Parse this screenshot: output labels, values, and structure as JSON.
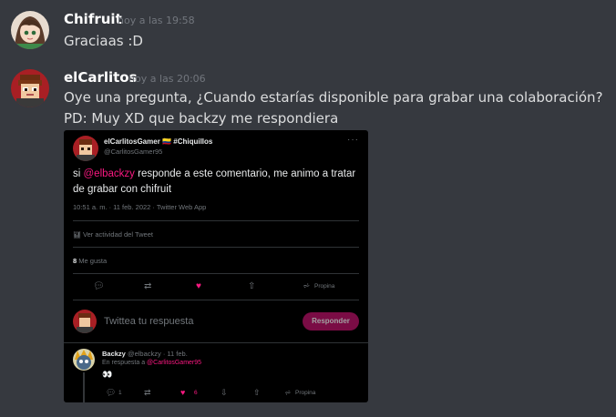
{
  "messages": [
    {
      "username": "Chifruit",
      "timestamp": "hoy a las 19:58",
      "lines": [
        "Graciaas :D"
      ],
      "avatar": "anime-girl-avatar"
    },
    {
      "username": "elCarlitos",
      "timestamp": "hoy a las 20:06",
      "lines": [
        "Oye una pregunta, ¿Cuando estarías disponible para grabar una colaboración?",
        "PD: Muy XD que backzy me respondiera"
      ],
      "avatar": "pixel-boy-avatar"
    }
  ],
  "tweet": {
    "author_name": "elCarlitosGamer",
    "author_flag": "🇨🇴",
    "author_tag": "#Chiquillos",
    "author_handle": "@CarlitosGamer95",
    "more": "···",
    "text_prefix": "si ",
    "mention": "@elbackzy",
    "text_suffix": " responde a este comentario, me animo a tratar de grabar con chifruit",
    "meta": "10:51 a. m. · 11 feb. 2022 · Twitter Web App",
    "activity": "Ver actividad del Tweet",
    "likes_count": "8",
    "likes_label": "Me gusta",
    "share_label": "Propina",
    "reply_placeholder": "Twittea tu respuesta",
    "reply_button": "Responder",
    "reply": {
      "author_name": "Backzy",
      "author_handle": "@elbackzy · 11 feb.",
      "in_reply_prefix": "En respuesta a ",
      "in_reply_handle": "@CarlitosGamer95",
      "text": "👀",
      "reply_count": "1",
      "like_count": "6",
      "tip_label": "Propina"
    }
  },
  "colors": {
    "background": "#36393f",
    "accent_pink": "#f91880",
    "username": "#ffffff",
    "timestamp": "#72767d"
  }
}
